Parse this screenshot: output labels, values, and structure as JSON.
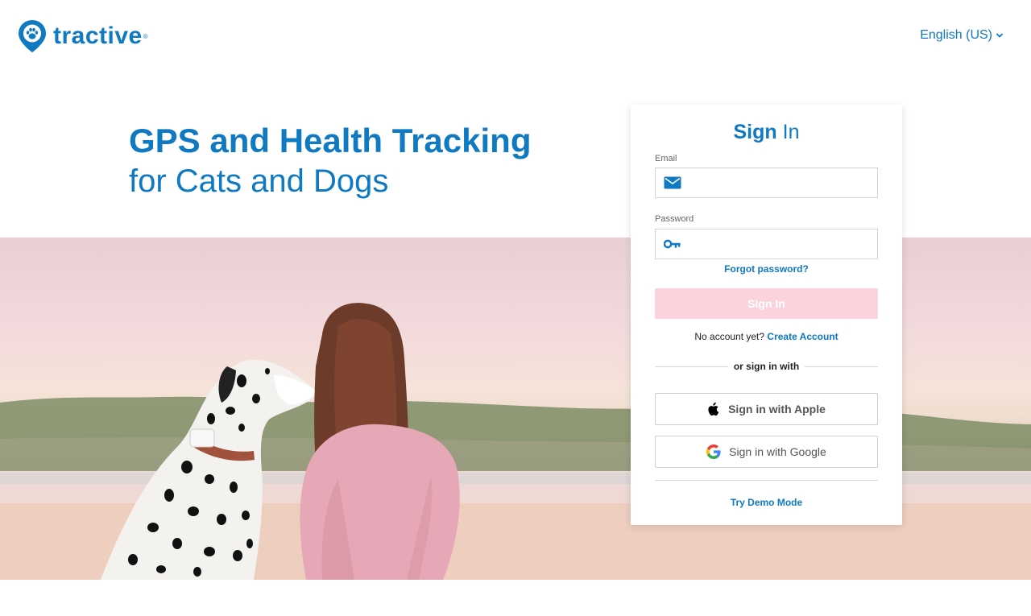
{
  "brand": {
    "name": "tractive",
    "registered_mark": "®",
    "primary_color": "#0f79c2",
    "pin_icon": "paw-pin-icon"
  },
  "header": {
    "language": "English (US)",
    "language_icon": "chevron-down-icon"
  },
  "hero": {
    "title_line1": "GPS and Health Tracking",
    "title_line2": "for Cats and Dogs",
    "image": "dalmatian-and-woman-by-lake-photo"
  },
  "signin": {
    "title_bold": "Sign",
    "title_light": "In",
    "email_label": "Email",
    "email_value": "",
    "email_icon": "envelope-icon",
    "password_label": "Password",
    "password_value": "",
    "password_icon": "key-icon",
    "forgot_password": "Forgot password?",
    "submit_label": "Sign In",
    "submit_color": "#fcd3dc",
    "no_account_text": "No account yet?",
    "create_account": "Create Account",
    "divider_text": "or sign in with",
    "apple_label": "Sign in with Apple",
    "google_label": "Sign in with Google",
    "demo_label": "Try Demo Mode"
  }
}
